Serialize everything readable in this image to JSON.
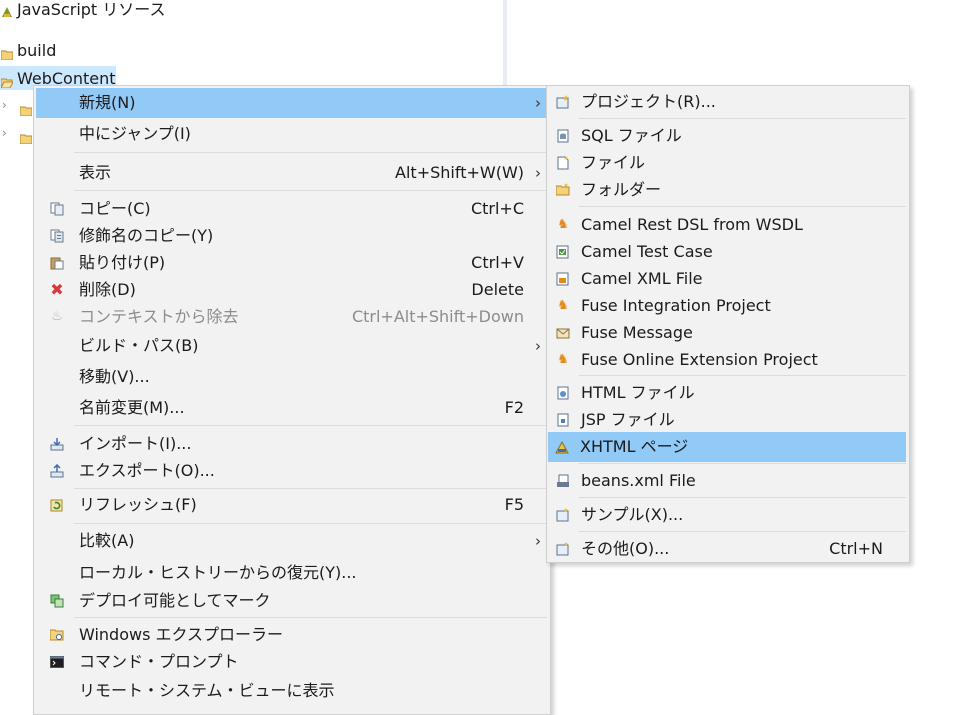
{
  "tree": {
    "items": [
      {
        "label": "JavaScript リソース",
        "icon": "javascript-resources-icon"
      },
      {
        "label": "build",
        "icon": "folder-icon"
      },
      {
        "label": "WebContent",
        "icon": "folder-open-icon"
      }
    ],
    "selection_color": "#cce8ff"
  },
  "context_menu": {
    "items": [
      {
        "label": "新規(N)",
        "arrow": "›",
        "icon": ""
      },
      {
        "label": "中にジャンプ(I)",
        "icon": ""
      },
      {
        "label": "表示",
        "shortcut": "Alt+Shift+W(W)",
        "arrow": "›"
      },
      {
        "label": "コピー(C)",
        "shortcut": "Ctrl+C",
        "icon": "copy-icon"
      },
      {
        "label": "修飾名のコピー(Y)",
        "icon": "copy-qualified-name-icon"
      },
      {
        "label": "貼り付け(P)",
        "shortcut": "Ctrl+V",
        "icon": "paste-icon"
      },
      {
        "label": "削除(D)",
        "shortcut": "Delete",
        "icon": "delete-icon"
      },
      {
        "label": "コンテキストから除去",
        "shortcut": "Ctrl+Alt+Shift+Down",
        "icon": "remove-from-context-icon"
      },
      {
        "label": "ビルド・パス(B)",
        "arrow": "›"
      },
      {
        "label": "移動(V)..."
      },
      {
        "label": "名前変更(M)...",
        "shortcut": "F2"
      },
      {
        "label": "インポート(I)...",
        "icon": "import-icon"
      },
      {
        "label": "エクスポート(O)...",
        "icon": "export-icon"
      },
      {
        "label": "リフレッシュ(F)",
        "shortcut": "F5",
        "icon": "refresh-icon"
      },
      {
        "label": "比較(A)",
        "arrow": "›"
      },
      {
        "label": "ローカル・ヒストリーからの復元(Y)..."
      },
      {
        "label": "デプロイ可能としてマーク",
        "icon": "deployable-icon"
      },
      {
        "label": "Windows エクスプローラー",
        "icon": "windows-explorer-icon"
      },
      {
        "label": "コマンド・プロンプト",
        "icon": "command-prompt-icon"
      },
      {
        "label": "リモート・システム・ビューに表示"
      }
    ]
  },
  "submenu": {
    "items": [
      {
        "label": "プロジェクト(R)...",
        "icon": "new-project-icon"
      },
      {
        "label": "SQL ファイル",
        "icon": "sql-file-icon"
      },
      {
        "label": "ファイル",
        "icon": "file-icon"
      },
      {
        "label": "フォルダー",
        "icon": "folder-icon"
      },
      {
        "label": "Camel Rest DSL from WSDL",
        "icon": "camel-icon"
      },
      {
        "label": "Camel Test Case",
        "icon": "camel-test-icon"
      },
      {
        "label": "Camel XML File",
        "icon": "camel-xml-icon"
      },
      {
        "label": "Fuse Integration Project",
        "icon": "camel-icon"
      },
      {
        "label": "Fuse Message",
        "icon": "fuse-message-icon"
      },
      {
        "label": "Fuse Online Extension Project",
        "icon": "camel-icon"
      },
      {
        "label": "HTML ファイル",
        "icon": "html-file-icon"
      },
      {
        "label": "JSP ファイル",
        "icon": "jsp-file-icon"
      },
      {
        "label": "XHTML ページ",
        "icon": "xhtml-page-icon"
      },
      {
        "label": "beans.xml File",
        "icon": "beans-xml-icon"
      },
      {
        "label": "サンプル(X)...",
        "icon": "sample-icon"
      },
      {
        "label": "その他(O)...",
        "shortcut": "Ctrl+N",
        "icon": "other-wizard-icon"
      }
    ]
  },
  "colors": {
    "menu_background": "#f2f2f2",
    "highlight": "#91c9f7",
    "disabled_text": "#8c8c8c"
  }
}
